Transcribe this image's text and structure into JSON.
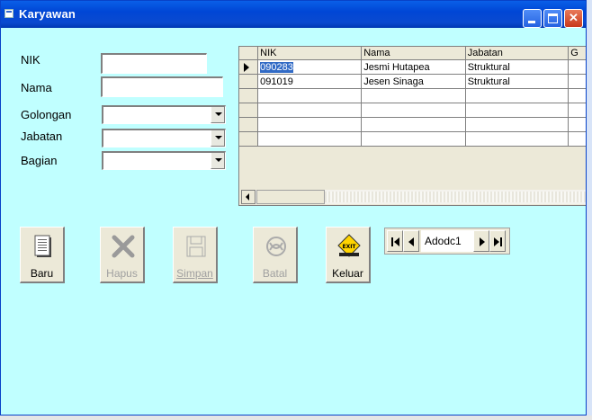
{
  "window": {
    "title": "Karyawan"
  },
  "form": {
    "nik_label": "NIK",
    "nama_label": "Nama",
    "golongan_label": "Golongan",
    "jabatan_label": "Jabatan",
    "bagian_label": "Bagian",
    "nik_value": "",
    "nama_value": "",
    "golongan_value": "",
    "jabatan_value": "",
    "bagian_value": ""
  },
  "grid": {
    "columns": [
      "NIK",
      "Nama",
      "Jabatan",
      "G"
    ],
    "rows": [
      [
        "090283",
        "Jesmi Hutapea",
        "Struktural",
        ""
      ],
      [
        "091019",
        "Jesen Sinaga",
        "Struktural",
        ""
      ]
    ]
  },
  "toolbar": {
    "baru": "Baru",
    "hapus": "Hapus",
    "simpan": "Simpan",
    "batal": "Batal",
    "keluar": "Keluar",
    "exit_sign": "EXIT"
  },
  "adodc": {
    "caption": "Adodc1"
  },
  "colors": {
    "form_bg": "#c0ffff",
    "title_bar": "#0a4ad0",
    "selection": "#316ac5"
  }
}
